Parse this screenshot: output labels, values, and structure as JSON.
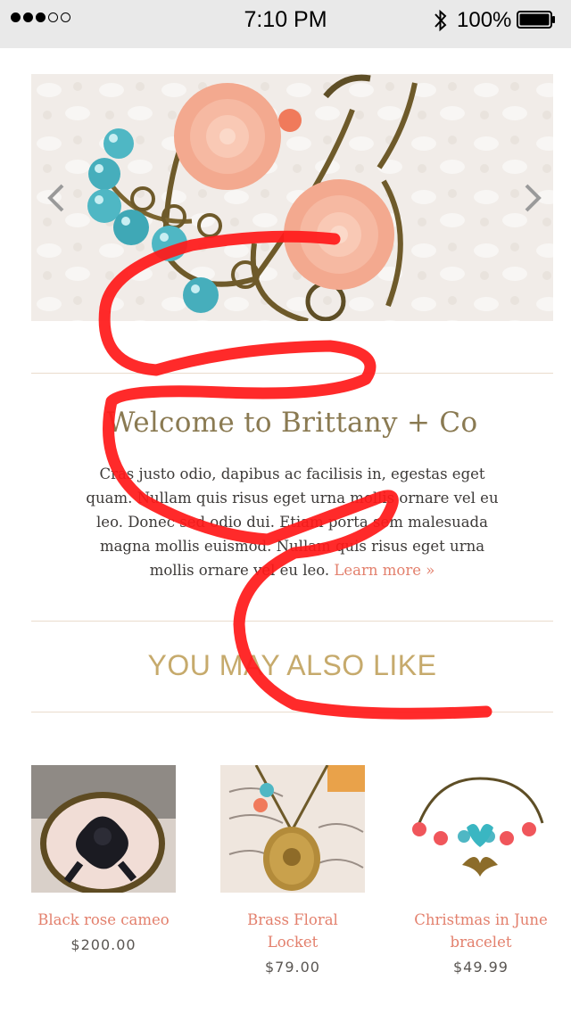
{
  "status_bar": {
    "time": "7:10 PM",
    "battery": "100%",
    "signal_icon": "signal-dots-icon",
    "bluetooth_icon": "bluetooth-icon",
    "battery_icon": "battery-icon"
  },
  "hero": {
    "image": "earrings-photo",
    "prev_icon": "chevron-left-icon",
    "next_icon": "chevron-right-icon"
  },
  "welcome": {
    "title": "Welcome to Brittany + Co",
    "body": "Cras justo odio, dapibus ac facilisis in, egestas eget quam. Nullam quis risus eget urna mollis ornare vel eu leo. Donec sed odio dui. Etiam porta sem malesuada magna mollis euismod. Nullam quis risus eget urna mollis ornare vel eu leo.",
    "learn_more": "Learn more »"
  },
  "also_like": {
    "heading": "YOU MAY ALSO LIKE",
    "products": [
      {
        "name": "Black rose cameo",
        "price": "$200.00"
      },
      {
        "name": "Brass Floral Locket",
        "price": "$79.00"
      },
      {
        "name": "Christmas in June bracelet",
        "price": "$49.99"
      }
    ]
  },
  "colors": {
    "accent": "#e3806d",
    "title": "#8a7a52",
    "heading": "#c6aa6c",
    "scribble": "#ff0000"
  }
}
